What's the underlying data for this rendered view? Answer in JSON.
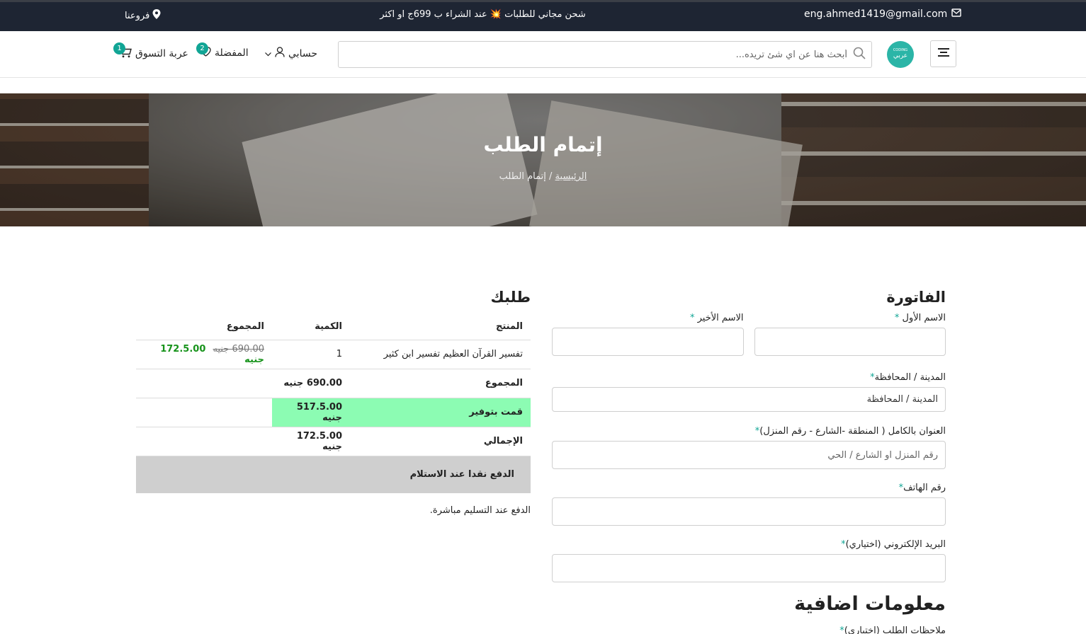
{
  "topbar": {
    "email": "eng.ahmed1419@gmail.com",
    "promo": "شحن مجاني للطلبات 💥 عند الشراء ب 699ج او اكثر",
    "branches": "فروعنا"
  },
  "header": {
    "logo_top": "CODING",
    "logo_main": "عربي",
    "search_placeholder": "أبحث هنا عن اي شئ تريده...",
    "account": "حسابي",
    "favorites": "المفضلة",
    "favorites_count": "2",
    "cart": "عربة التسوق",
    "cart_count": "1"
  },
  "banner": {
    "title": "إتمام الطلب",
    "breadcrumb_home": "الرئيسية",
    "breadcrumb_sep": "/",
    "breadcrumb_current": "إتمام الطلب"
  },
  "billing": {
    "title": "الفاتورة",
    "first_name_label": "الاسم الأول",
    "last_name_label": "الاسم الأخير",
    "city_label": "المدينة / المحافظة",
    "city_value": "المدينة / المحافظة",
    "address_label": "العنوان بالكامل ( المنطقة -الشارع - رقم المنزل)",
    "address_placeholder": "رقم المنزل او الشارع / الحي",
    "phone_label": "رقم الهاتف",
    "email_label": "البريد الإلكتروني (اختياري)",
    "required_mark": "*",
    "extra_title": "معلومات اضافية",
    "notes_label": "ملاحظات الطلب (اختياري)"
  },
  "order": {
    "title": "طلبك",
    "columns": [
      "المنتج",
      "الكمية",
      "المجموع"
    ],
    "item": {
      "name": "تفسير القرآن العظيم تفسير ابن كثير",
      "qty": "1",
      "old_price": "690.00 جنيه",
      "new_price": "172.5.00 جنيه"
    },
    "subtotal_label": "المجموع",
    "subtotal_value": "690.00 جنيه",
    "saved_label": "قمت بتوفير",
    "saved_value": "517.5.00 جنيه",
    "total_label": "الإجمالي",
    "total_value": "172.5.00 جنيه",
    "payment_method": "الدفع نقدا عند الاستلام",
    "payment_desc": "الدفع عند التسليم مباشرة."
  },
  "colors": {
    "topbar_bg": "#1e2533",
    "accent": "#11a595",
    "saved_highlight": "#8cfcb3",
    "price_green": "#17931b"
  }
}
